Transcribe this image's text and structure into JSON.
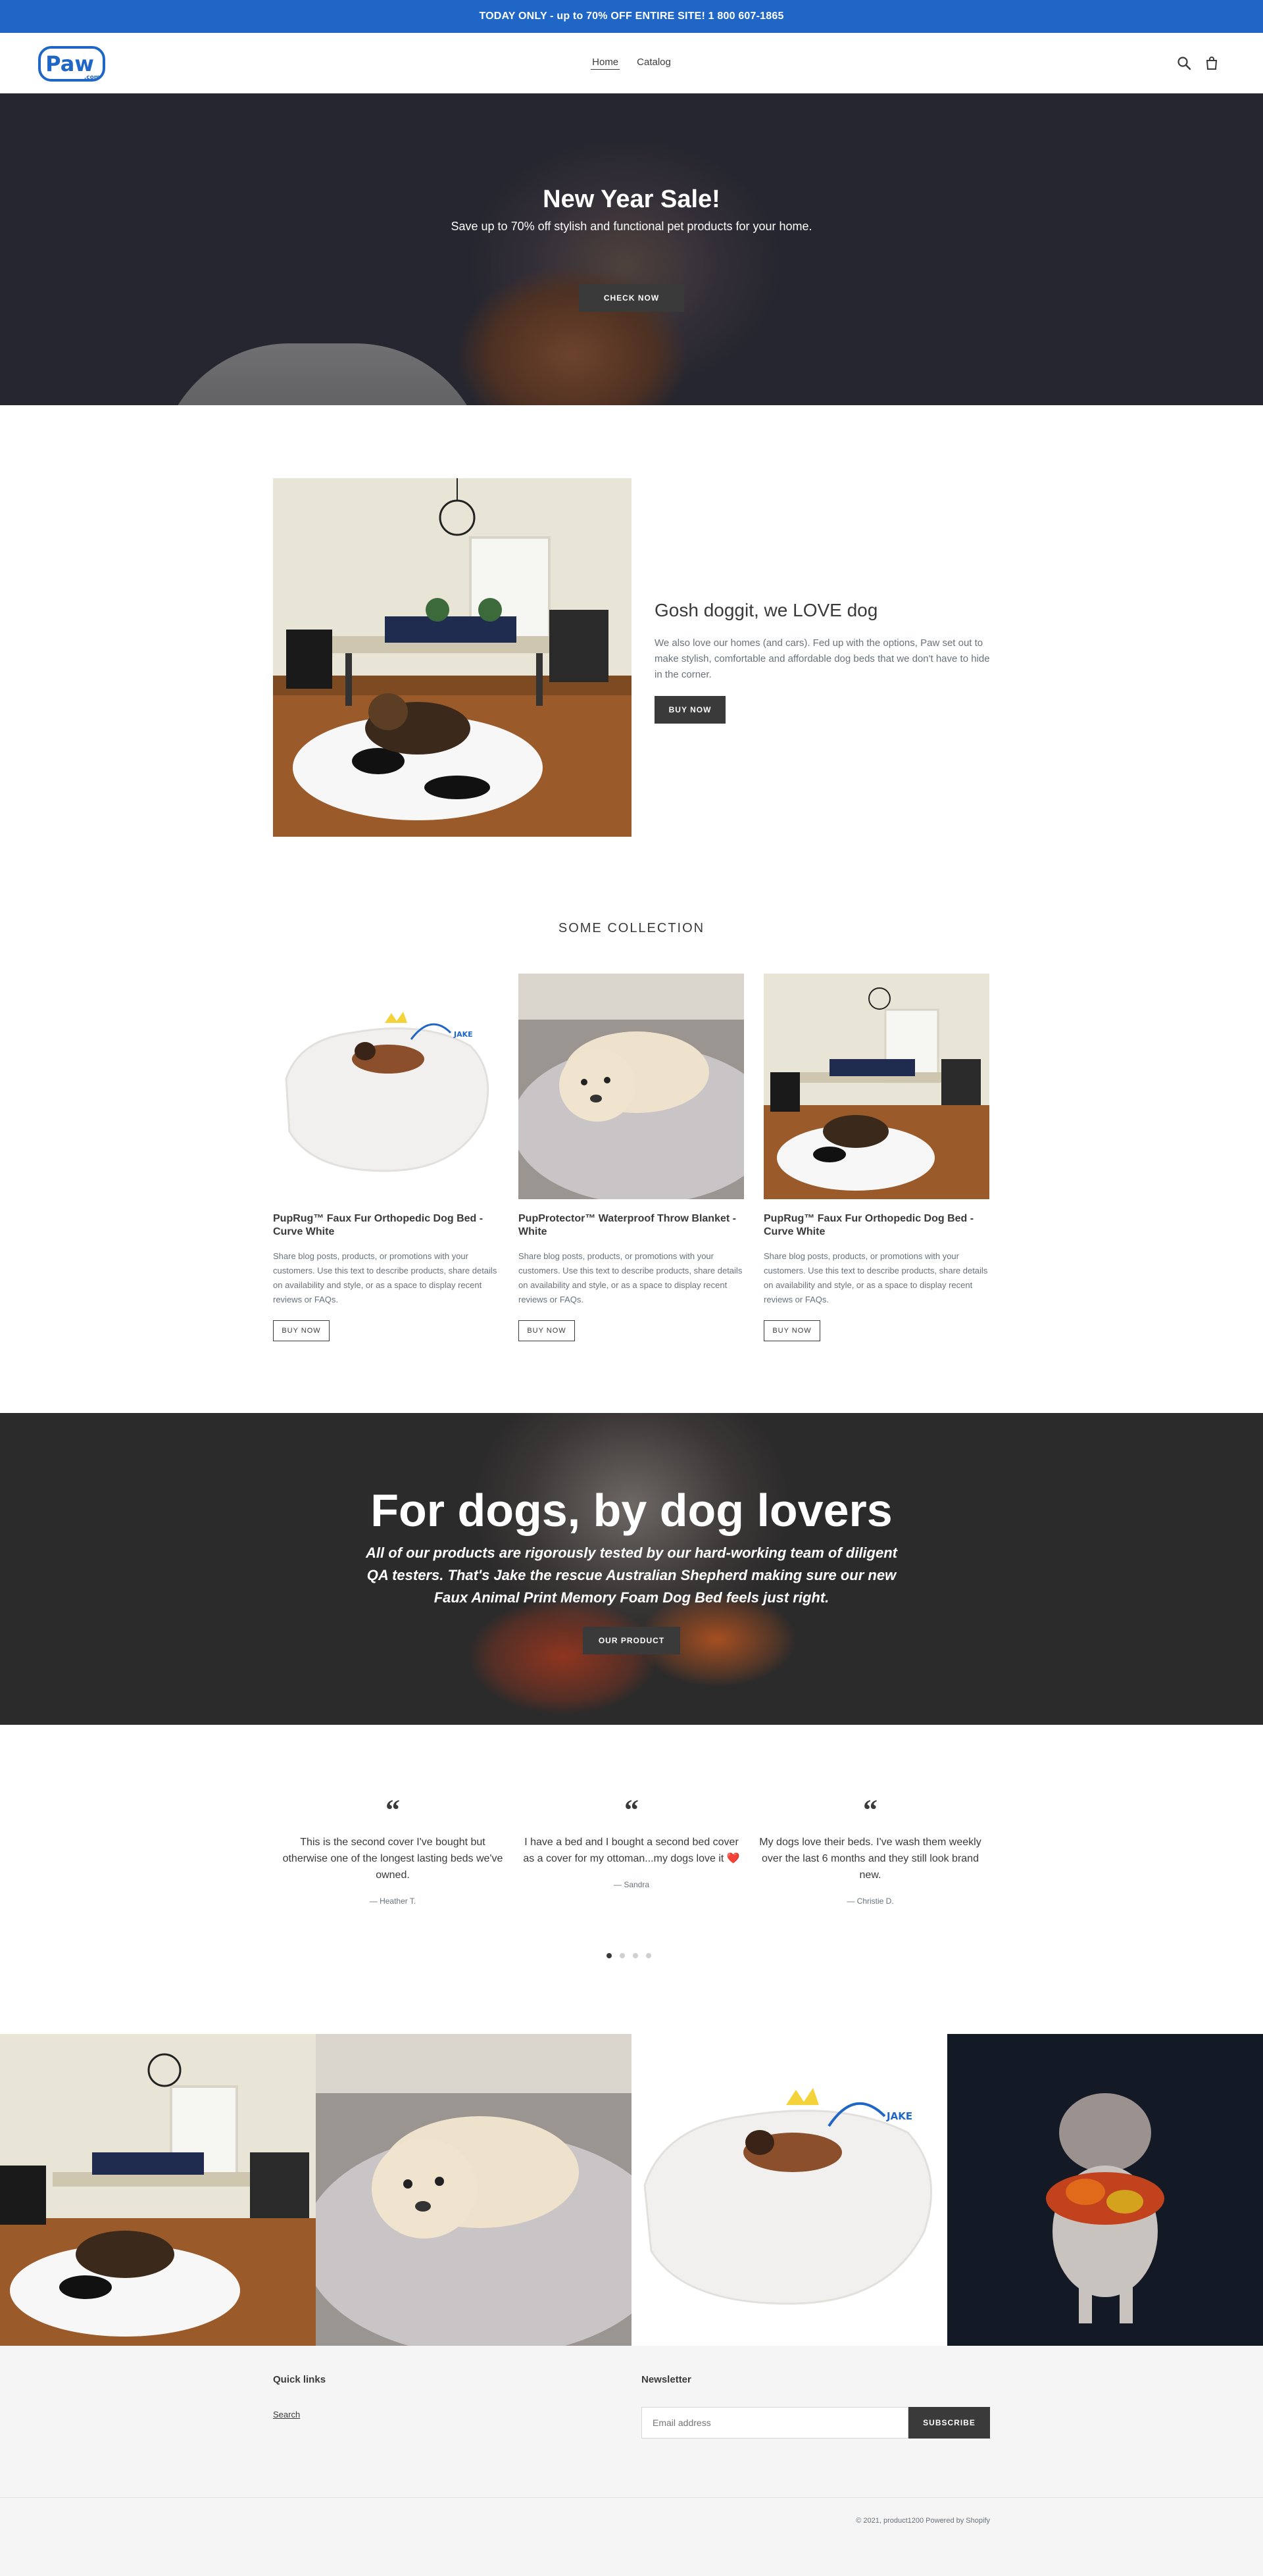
{
  "announcement": {
    "text": "TODAY ONLY - up to 70% OFF ENTIRE SITE! 1 800 607-1865"
  },
  "header": {
    "logo_text": "Paw",
    "logo_sub": ".com",
    "nav": [
      {
        "label": "Home",
        "active": true
      },
      {
        "label": "Catalog",
        "active": false
      }
    ],
    "icons": [
      "search-icon",
      "cart-icon"
    ],
    "brand_color": "#1f66c7"
  },
  "hero": {
    "title": "New Year Sale!",
    "subtitle": "Save up to 70% off stylish and functional pet products for your home.",
    "button": "CHECK NOW"
  },
  "feature": {
    "title": "Gosh doggit, we LOVE dog",
    "text": "We also love our homes (and cars). Fed up with the options, Paw set out to make stylish, comfortable and affordable dog beds that we don't have to hide in the corner.",
    "button": "BUY NOW"
  },
  "collection": {
    "title": "SOME COLLECTION",
    "items": [
      {
        "title": "PupRug™ Faux Fur Orthopedic Dog Bed - Curve White",
        "text": "Share blog posts, products, or promotions with your customers. Use this text to describe products, share details on availability and style, or as a space to display recent reviews or FAQs.",
        "button": "BUY NOW",
        "image_tag": "JAKE"
      },
      {
        "title": "PupProtector™ Waterproof Throw Blanket - White",
        "text": "Share blog posts, products, or promotions with your customers. Use this text to describe products, share details on availability and style, or as a space to display recent reviews or FAQs.",
        "button": "BUY NOW"
      },
      {
        "title": "PupRug™ Faux Fur Orthopedic Dog Bed - Curve White",
        "text": "Share blog posts, products, or promotions with your customers. Use this text to describe products, share details on availability and style, or as a space to display recent reviews or FAQs.",
        "button": "BUY NOW"
      }
    ]
  },
  "banner": {
    "title": "For dogs, by dog lovers",
    "text": "All of our products are rigorously tested by our hard-working team of diligent QA testers. That's Jake the rescue Australian Shepherd making sure our new Faux Animal Print Memory Foam Dog Bed feels just right.",
    "button": "OUR PRODUCT"
  },
  "testimonials": {
    "quote_mark": "“",
    "items": [
      {
        "text": "This is the second cover I've bought but otherwise one of the longest lasting beds we've owned.",
        "author": "— Heather T."
      },
      {
        "text": "I have a bed and I bought a second bed cover as a cover for my ottoman...my dogs love it ❤️",
        "author": "— Sandra"
      },
      {
        "text": "My dogs love their beds. I've wash them weekly over the last 6 months and they still look brand new.",
        "author": "— Christie D."
      }
    ],
    "dots": 4,
    "active_dot": 0
  },
  "gallery": {
    "image_tag": "JAKE"
  },
  "footer": {
    "quick_links_title": "Quick links",
    "links": [
      "Search"
    ],
    "newsletter_title": "Newsletter",
    "email_placeholder": "Email address",
    "subscribe": "SUBSCRIBE",
    "copyright": "© 2021, product1200 Powered by Shopify"
  }
}
